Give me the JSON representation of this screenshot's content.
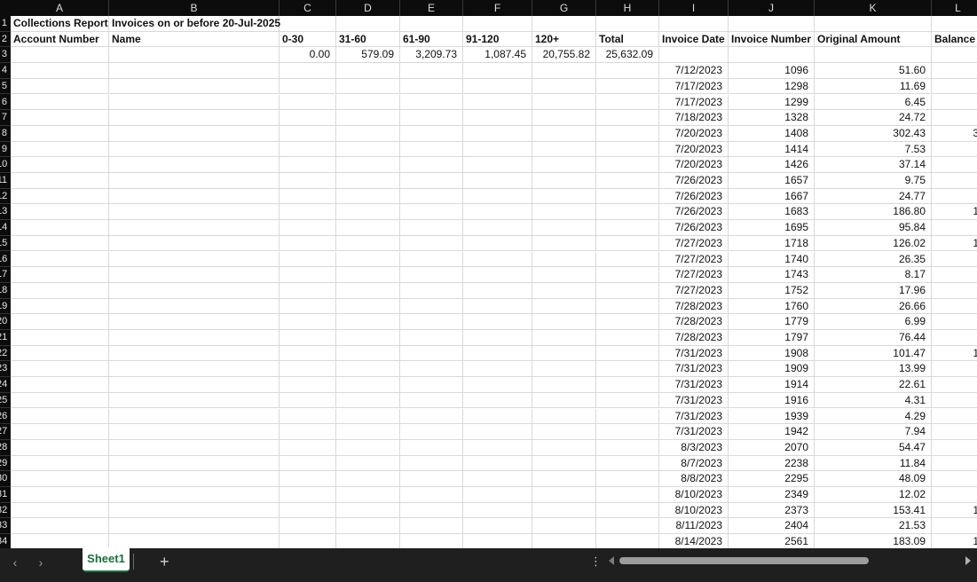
{
  "columns": [
    "A",
    "B",
    "C",
    "D",
    "E",
    "F",
    "G",
    "H",
    "I",
    "J",
    "K",
    "L"
  ],
  "row_numbers": [
    "1",
    "2",
    "3",
    "4",
    "5",
    "6",
    "7",
    "8",
    "9",
    "10",
    "11",
    "12",
    "13",
    "14",
    "15",
    "16",
    "17",
    "18",
    "19",
    "20",
    "21",
    "22",
    "23",
    "24",
    "25",
    "26",
    "27",
    "28",
    "29",
    "30",
    "31",
    "32",
    "33",
    "34"
  ],
  "row1": {
    "a": "Collections Report",
    "b": "Invoices on or before 20-Jul-2025"
  },
  "headers": {
    "a": "Account Number",
    "b": "Name",
    "c": "0-30",
    "d": "31-60",
    "e": "61-90",
    "f": "91-120",
    "g": "120+",
    "h": "Total",
    "i": "Invoice Date",
    "j": "Invoice Number",
    "k": "Original Amount",
    "l": "Balance"
  },
  "totals": {
    "c": "0.00",
    "d": "579.09",
    "e": "3,209.73",
    "f": "1,087.45",
    "g": "20,755.82",
    "h": "25,632.09"
  },
  "invoices": [
    {
      "date": "7/12/2023",
      "num": "1096",
      "amt": "51.60",
      "bal": ""
    },
    {
      "date": "7/17/2023",
      "num": "1298",
      "amt": "11.69",
      "bal": ""
    },
    {
      "date": "7/17/2023",
      "num": "1299",
      "amt": "6.45",
      "bal": ""
    },
    {
      "date": "7/18/2023",
      "num": "1328",
      "amt": "24.72",
      "bal": ""
    },
    {
      "date": "7/20/2023",
      "num": "1408",
      "amt": "302.43",
      "bal": "3"
    },
    {
      "date": "7/20/2023",
      "num": "1414",
      "amt": "7.53",
      "bal": ""
    },
    {
      "date": "7/20/2023",
      "num": "1426",
      "amt": "37.14",
      "bal": ""
    },
    {
      "date": "7/26/2023",
      "num": "1657",
      "amt": "9.75",
      "bal": ""
    },
    {
      "date": "7/26/2023",
      "num": "1667",
      "amt": "24.77",
      "bal": ""
    },
    {
      "date": "7/26/2023",
      "num": "1683",
      "amt": "186.80",
      "bal": "1"
    },
    {
      "date": "7/26/2023",
      "num": "1695",
      "amt": "95.84",
      "bal": ""
    },
    {
      "date": "7/27/2023",
      "num": "1718",
      "amt": "126.02",
      "bal": "1"
    },
    {
      "date": "7/27/2023",
      "num": "1740",
      "amt": "26.35",
      "bal": ""
    },
    {
      "date": "7/27/2023",
      "num": "1743",
      "amt": "8.17",
      "bal": ""
    },
    {
      "date": "7/27/2023",
      "num": "1752",
      "amt": "17.96",
      "bal": ""
    },
    {
      "date": "7/28/2023",
      "num": "1760",
      "amt": "26.66",
      "bal": ""
    },
    {
      "date": "7/28/2023",
      "num": "1779",
      "amt": "6.99",
      "bal": ""
    },
    {
      "date": "7/28/2023",
      "num": "1797",
      "amt": "76.44",
      "bal": ""
    },
    {
      "date": "7/31/2023",
      "num": "1908",
      "amt": "101.47",
      "bal": "1"
    },
    {
      "date": "7/31/2023",
      "num": "1909",
      "amt": "13.99",
      "bal": ""
    },
    {
      "date": "7/31/2023",
      "num": "1914",
      "amt": "22.61",
      "bal": ""
    },
    {
      "date": "7/31/2023",
      "num": "1916",
      "amt": "4.31",
      "bal": ""
    },
    {
      "date": "7/31/2023",
      "num": "1939",
      "amt": "4.29",
      "bal": ""
    },
    {
      "date": "7/31/2023",
      "num": "1942",
      "amt": "7.94",
      "bal": ""
    },
    {
      "date": "8/3/2023",
      "num": "2070",
      "amt": "54.47",
      "bal": ""
    },
    {
      "date": "8/7/2023",
      "num": "2238",
      "amt": "11.84",
      "bal": ""
    },
    {
      "date": "8/8/2023",
      "num": "2295",
      "amt": "48.09",
      "bal": ""
    },
    {
      "date": "8/10/2023",
      "num": "2349",
      "amt": "12.02",
      "bal": ""
    },
    {
      "date": "8/10/2023",
      "num": "2373",
      "amt": "153.41",
      "bal": "1"
    },
    {
      "date": "8/11/2023",
      "num": "2404",
      "amt": "21.53",
      "bal": ""
    },
    {
      "date": "8/14/2023",
      "num": "2561",
      "amt": "183.09",
      "bal": "1"
    }
  ],
  "tabs": {
    "active": "Sheet1",
    "add": "+"
  },
  "nav": {
    "prev": "‹",
    "next": "›",
    "more": "⋮"
  },
  "icons": {
    "prev": "chevron-left-icon",
    "next": "chevron-right-icon",
    "add": "plus-icon",
    "more": "vertical-ellipsis-icon",
    "scroll_left": "triangle-left-icon",
    "scroll_right": "triangle-right-icon"
  },
  "scroll": {
    "horizontal_thumb_fraction": 0.73
  },
  "colors": {
    "tab_accent": "#1b6e3a",
    "header_bg": "#0c0c0c",
    "grid": "#d9d9d9"
  }
}
